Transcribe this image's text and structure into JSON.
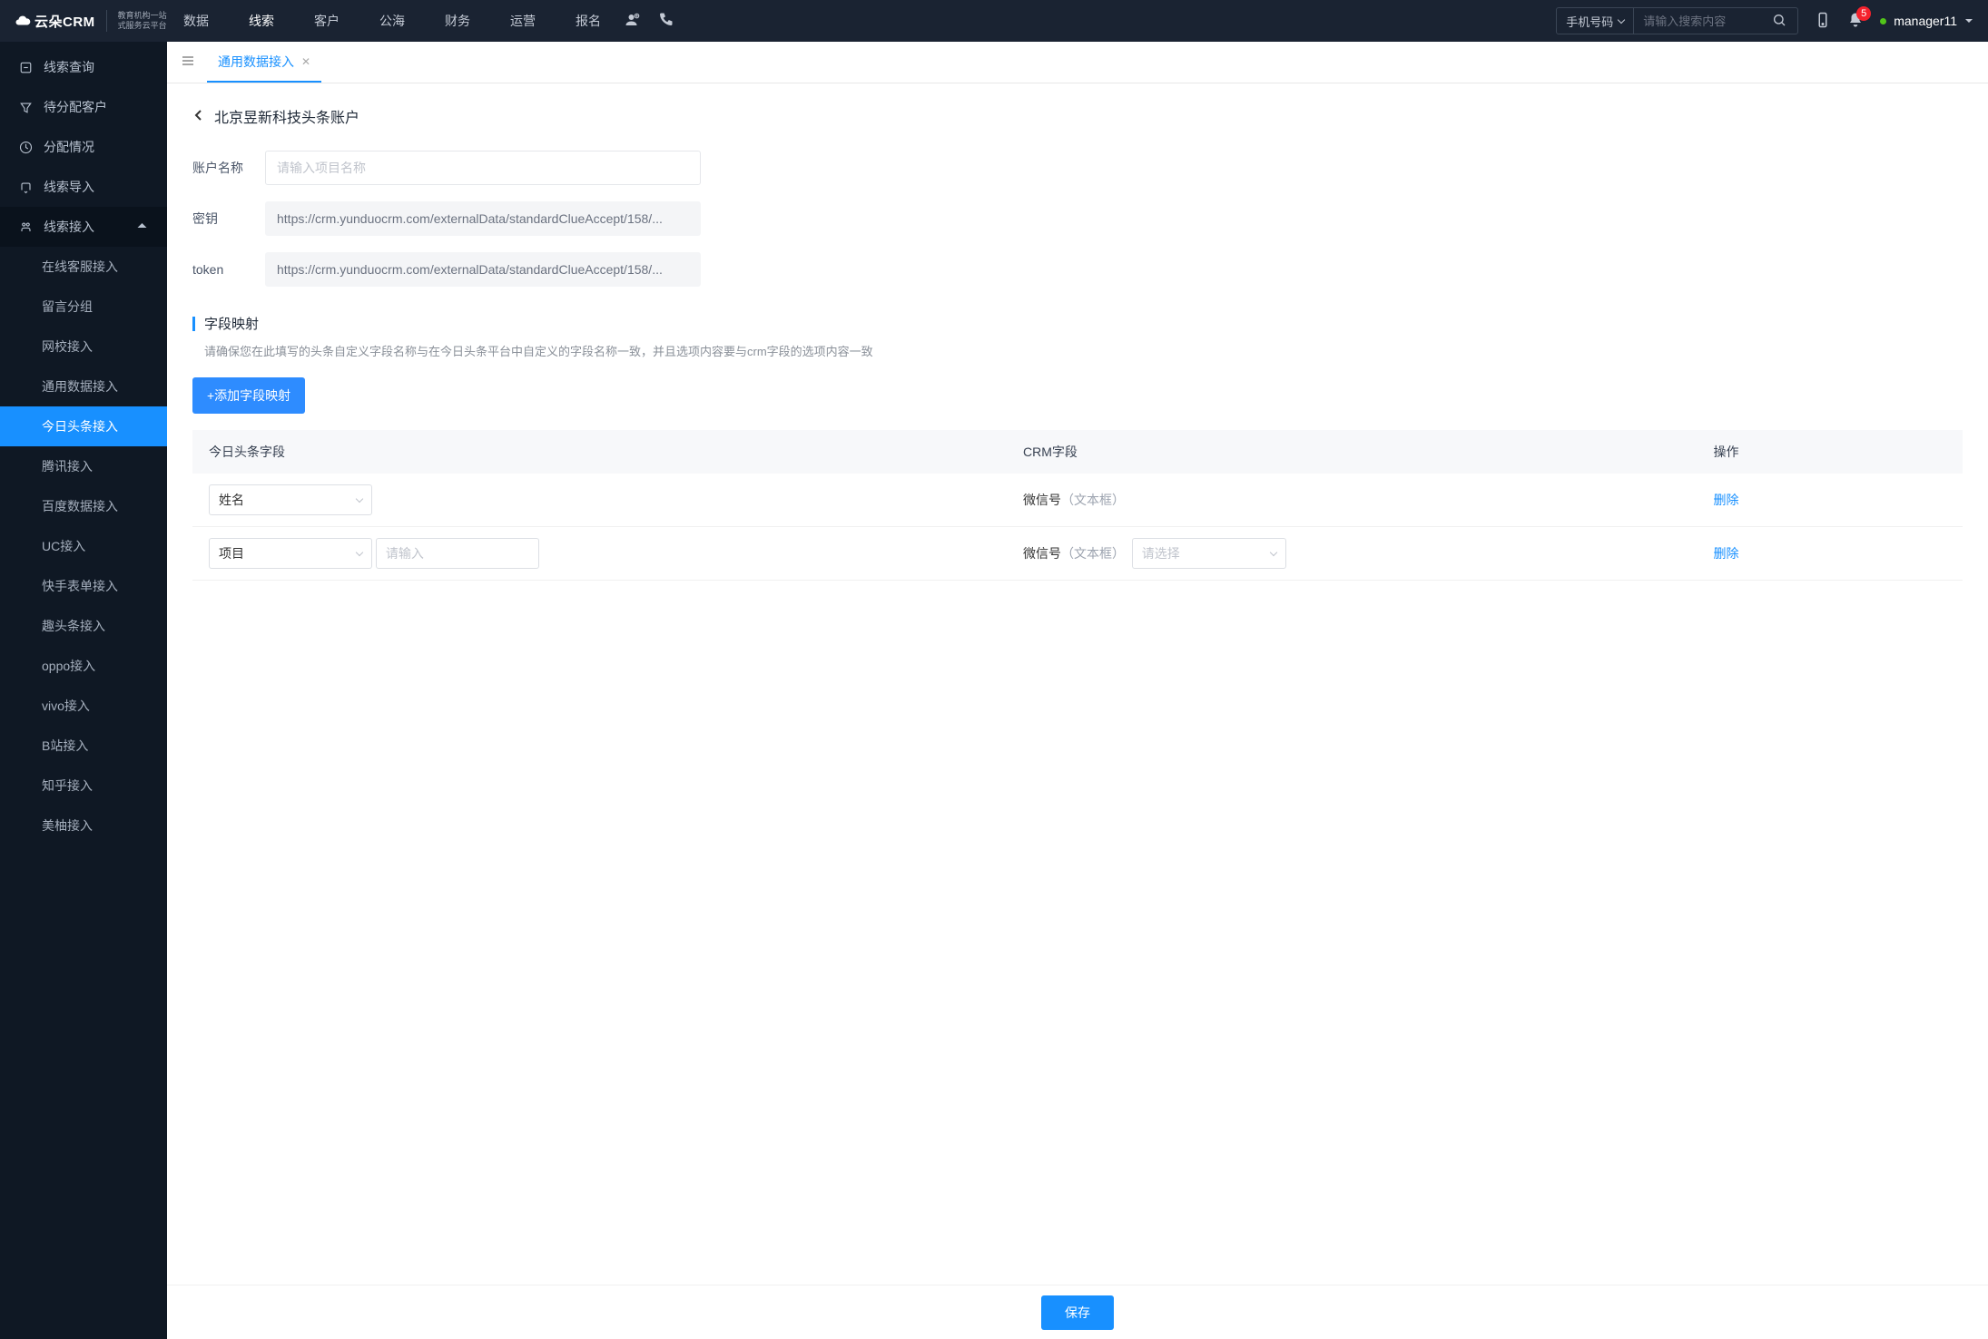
{
  "header": {
    "logo_text": "云朵CRM",
    "logo_sub1": "教育机构一站",
    "logo_sub2": "式服务云平台",
    "logo_url": "www.yunduocrm.com",
    "nav": [
      "数据",
      "线索",
      "客户",
      "公海",
      "财务",
      "运营",
      "报名"
    ],
    "nav_active": 1,
    "search_type": "手机号码",
    "search_placeholder": "请输入搜索内容",
    "badge": "5",
    "user": "manager11"
  },
  "sidebar": {
    "items": [
      {
        "label": "线索查询"
      },
      {
        "label": "待分配客户"
      },
      {
        "label": "分配情况"
      },
      {
        "label": "线索导入"
      },
      {
        "label": "线索接入",
        "expanded": true,
        "children": [
          "在线客服接入",
          "留言分组",
          "网校接入",
          "通用数据接入",
          "今日头条接入",
          "腾讯接入",
          "百度数据接入",
          "UC接入",
          "快手表单接入",
          "趣头条接入",
          "oppo接入",
          "vivo接入",
          "B站接入",
          "知乎接入",
          "美柚接入"
        ],
        "active_child": 4
      }
    ]
  },
  "tabs": {
    "items": [
      "通用数据接入"
    ],
    "active": 0
  },
  "page": {
    "title": "北京昱新科技头条账户",
    "form": {
      "account_label": "账户名称",
      "account_placeholder": "请输入项目名称",
      "secret_label": "密钥",
      "secret_value": "https://crm.yunduocrm.com/externalData/standardClueAccept/158/...",
      "token_label": "token",
      "token_value": "https://crm.yunduocrm.com/externalData/standardClueAccept/158/..."
    },
    "mapping": {
      "title": "字段映射",
      "hint": "请确保您在此填写的头条自定义字段名称与在今日头条平台中自定义的字段名称一致，并且选项内容要与crm字段的选项内容一致",
      "add_button": "+添加字段映射",
      "columns": [
        "今日头条字段",
        "CRM字段",
        "操作"
      ],
      "rows": [
        {
          "tt_field": "姓名",
          "extra_input": false,
          "crm_label": "微信号",
          "crm_type": "（文本框）",
          "crm_select": false,
          "action": "删除"
        },
        {
          "tt_field": "项目",
          "extra_input": true,
          "extra_placeholder": "请输入",
          "crm_label": "微信号",
          "crm_type": "（文本框）",
          "crm_select": true,
          "crm_select_placeholder": "请选择",
          "action": "删除"
        }
      ]
    },
    "save": "保存"
  }
}
